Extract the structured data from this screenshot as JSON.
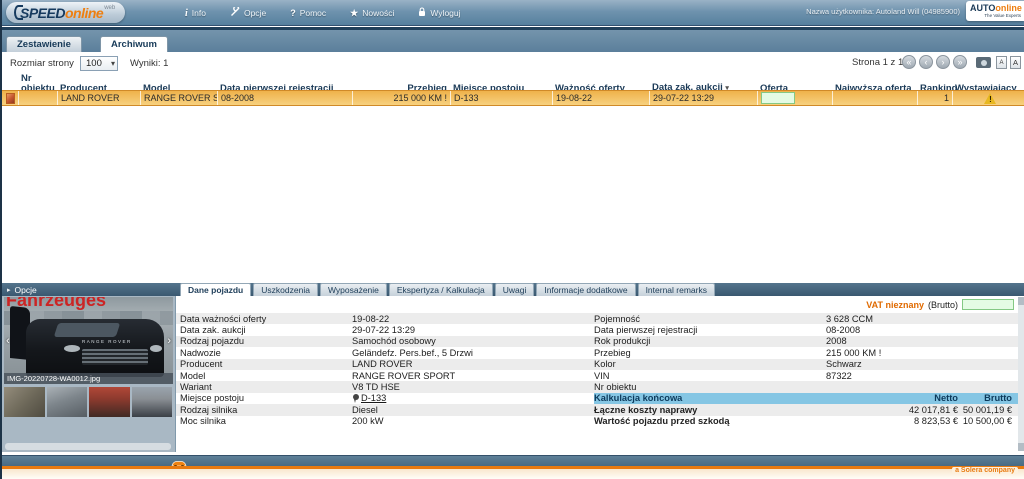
{
  "header": {
    "logo_speed": "SPEED",
    "logo_online": "online",
    "logo_web": "web",
    "menu": [
      {
        "label": "Info",
        "glyph": "i"
      },
      {
        "label": "Opcje"
      },
      {
        "label": "Pomoc",
        "glyph": "?"
      },
      {
        "label": "Nowości",
        "glyph": "★"
      },
      {
        "label": "Wyloguj"
      }
    ],
    "username": "Nazwa użytkownika: Autoland Will (04985900)",
    "brand_auto": "AUTO",
    "brand_online": "online",
    "brand_tagline": "The Value Experts"
  },
  "nav_tabs": {
    "zestawienie": "Zestawienie",
    "archiwum": "Archiwum"
  },
  "toolbar": {
    "page_size_label": "Rozmiar strony",
    "page_size_value": "100",
    "results": "Wyniki: 1",
    "page_info": "Strona 1 z 1"
  },
  "table": {
    "columns": {
      "nr": "Nr obiektu",
      "producent": "Producent",
      "model": "Model",
      "rejestracja": "Data pierwszej rejestracji",
      "przebieg": "Przebieg",
      "miejsce": "Miejsce postoju",
      "waznosc": "Ważność oferty",
      "data_zak": "Data zak. aukcji",
      "oferta": "Oferta",
      "najwyzsza": "Najwyższa oferta",
      "ranking": "Ranking",
      "wystawiajacy": "Wystawiający"
    },
    "row": {
      "producent": "LAND ROVER",
      "model": "RANGE ROVER SPOR...",
      "rejestracja": "08-2008",
      "przebieg": "215 000 KM !",
      "miejsce": "D-133",
      "waznosc": "19-08-22",
      "data_zak": "29-07-22 13:29",
      "ranking": "1"
    }
  },
  "details": {
    "options_label": "Opcje",
    "photo": {
      "watermark": "Fahrzeuges",
      "hood_text": "RANGE ROVER",
      "caption": "IMG-20220728-WA0012.jpg"
    },
    "tabs": [
      "Dane pojazdu",
      "Uszkodzenia",
      "Wyposażenie",
      "Ekspertyza / Kalkulacja",
      "Uwagi",
      "Informacje dodatkowe",
      "Internal remarks"
    ],
    "vat_label": "VAT nieznany",
    "vat_suffix": "(Brutto)",
    "fields_left": [
      {
        "label": "Data ważności oferty",
        "value": "19-08-22"
      },
      {
        "label": "Data zak. aukcji",
        "value": "29-07-22 13:29"
      },
      {
        "label": "Rodzaj pojazdu",
        "value": "Samochód osobowy"
      },
      {
        "label": "Nadwozie",
        "value": "Geländefz. Pers.bef., 5 Drzwi"
      },
      {
        "label": "Producent",
        "value": "LAND ROVER"
      },
      {
        "label": "Model",
        "value": "RANGE ROVER SPORT"
      },
      {
        "label": "Wariant",
        "value": "V8 TD HSE"
      },
      {
        "label": "Miejsce postoju",
        "value": "D-133"
      },
      {
        "label": "Rodzaj silnika",
        "value": "Diesel"
      },
      {
        "label": "Moc silnika",
        "value": "200 kW"
      }
    ],
    "fields_right": [
      {
        "label": "Pojemność",
        "value": "3 628 CCM"
      },
      {
        "label": "Data pierwszej rejestracji",
        "value": "08-2008"
      },
      {
        "label": "Rok produkcji",
        "value": "2008"
      },
      {
        "label": "Przebieg",
        "value": "215 000 KM !"
      },
      {
        "label": "Kolor",
        "value": "Schwarz"
      },
      {
        "label": "VIN",
        "value": "87322"
      },
      {
        "label": "Nr obiektu",
        "value": ""
      }
    ],
    "calc": {
      "title": "Kalkulacja końcowa",
      "col_netto": "Netto",
      "col_brutto": "Brutto",
      "rows": [
        {
          "label": "Łączne koszty naprawy",
          "netto": "42 017,81 €",
          "brutto": "50 001,19 €"
        },
        {
          "label": "Wartość pojazdu przed szkodą",
          "netto": "8 823,53 €",
          "brutto": "10 500,00 €"
        }
      ]
    }
  },
  "footer": {
    "company": "a Solera company"
  },
  "icons": {
    "select_arrow": "▾",
    "sort_arrow": "▾",
    "page_first": "«",
    "page_prev": "‹",
    "page_next": "›",
    "page_last": "»",
    "font_a": "A",
    "options_arrow": "▸",
    "photo_prev": "‹",
    "photo_next": "›",
    "warning_mark": "!"
  }
}
